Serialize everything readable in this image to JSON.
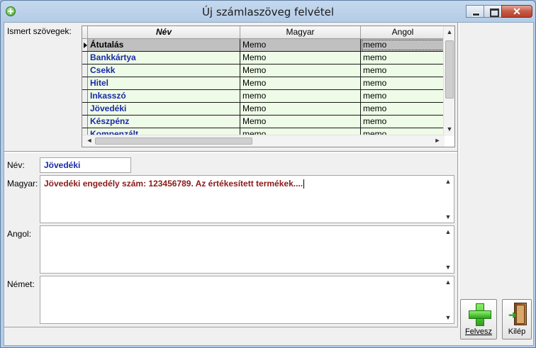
{
  "window": {
    "title": "Új számlaszöveg felvétel",
    "close_glyph": "✕"
  },
  "labels": {
    "known_texts": "Ismert szövegek:",
    "name": "Név:",
    "hungarian": "Magyar:",
    "english": "Angol:",
    "german": "Német:"
  },
  "grid": {
    "columns": [
      "Név",
      "Magyar",
      "Angol"
    ],
    "rows": [
      [
        "Átutalás",
        "Memo",
        "memo"
      ],
      [
        "Bankkártya",
        "Memo",
        "memo"
      ],
      [
        "Csekk",
        "Memo",
        "memo"
      ],
      [
        "Hitel",
        "Memo",
        "memo"
      ],
      [
        "Inkasszó",
        "memo",
        "memo"
      ],
      [
        "Jövedéki",
        "Memo",
        "memo"
      ],
      [
        "Készpénz",
        "Memo",
        "memo"
      ],
      [
        "Kompenzált",
        "memo",
        "memo"
      ]
    ],
    "selected_row": 0
  },
  "form": {
    "name_value": "Jövedéki",
    "hungarian_value": "Jövedéki engedély szám: 123456789. Az értékesített termékek....",
    "english_value": "",
    "german_value": ""
  },
  "buttons": {
    "add": "Felvesz",
    "exit": "Kilép"
  },
  "scroll": {
    "up": "▲",
    "down": "▼",
    "left": "◄",
    "right": "►"
  },
  "icons": {
    "add": "plus-icon",
    "exit": "door-exit-icon",
    "app": "add-circle-icon"
  }
}
